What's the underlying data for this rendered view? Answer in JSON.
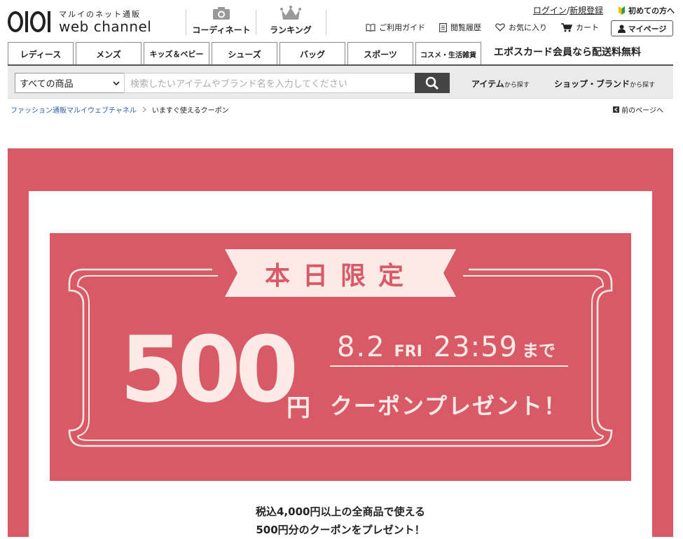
{
  "header": {
    "logo_sub": "マルイのネット通販",
    "logo_main": "web channel",
    "nav": [
      {
        "label": "コーディネート",
        "icon": "camera-icon"
      },
      {
        "label": "ランキング",
        "icon": "crown-icon"
      }
    ],
    "login": "ログイン",
    "slash": "/",
    "register": "新規登録",
    "first_time": "初めての方へ",
    "guide": "ご利用ガイド",
    "history": "閲覧履歴",
    "favorites": "お気に入り",
    "cart": "カート",
    "mypage": "マイページ"
  },
  "categories": [
    "レディース",
    "メンズ",
    "キッズ＆ベビー",
    "シューズ",
    "バッグ",
    "スポーツ",
    "コスメ・生活雑貨"
  ],
  "promo": "エポスカード会員なら配送料無料",
  "search": {
    "select_value": "すべての商品",
    "placeholder": "検索したいアイテムやブランド名を入力してください",
    "find_item": "アイテム",
    "find_item_small": "から探す",
    "find_shop": "ショップ・ブランド",
    "find_shop_small": "から探す"
  },
  "breadcrumb": {
    "home": "ファッション通販マルイウェブチャネル",
    "current": "いますぐ使えるクーポン",
    "back": "前のページへ"
  },
  "banner": {
    "ribbon": "本日限定",
    "amount": "500",
    "yen": "円",
    "date": "8.2",
    "weekday": "FRI",
    "time": "23:59",
    "until": "まで",
    "present": "クーポンプレゼント！",
    "desc_line1": "税込4,000円以上の全商品で使える",
    "desc_line2": "500円分のクーポンをプレゼント！"
  },
  "colors": {
    "accent": "#d85a67",
    "cream": "#fde9e6",
    "button_dark": "#444444"
  }
}
